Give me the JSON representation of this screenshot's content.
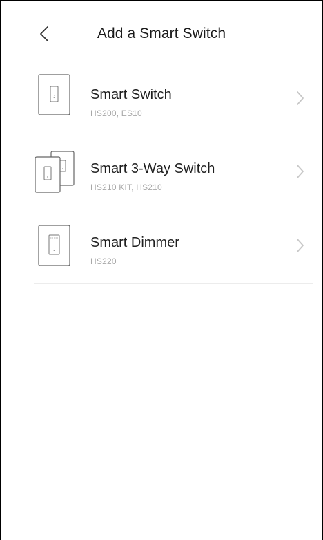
{
  "header": {
    "title": "Add a Smart Switch",
    "back_icon": "chevron-left-icon"
  },
  "devices": [
    {
      "name": "Smart Switch",
      "models": "HS200, ES10",
      "icon": "single-switch-icon"
    },
    {
      "name": "Smart 3-Way Switch",
      "models": "HS210 KIT, HS210",
      "icon": "three-way-switch-icon"
    },
    {
      "name": "Smart Dimmer",
      "models": "HS220",
      "icon": "dimmer-switch-icon"
    }
  ],
  "colors": {
    "text_primary": "#1f1f1f",
    "text_secondary": "#a8a8a8",
    "divider": "#ececec",
    "chevron": "#c7c7c7",
    "icon_stroke": "#666666"
  }
}
